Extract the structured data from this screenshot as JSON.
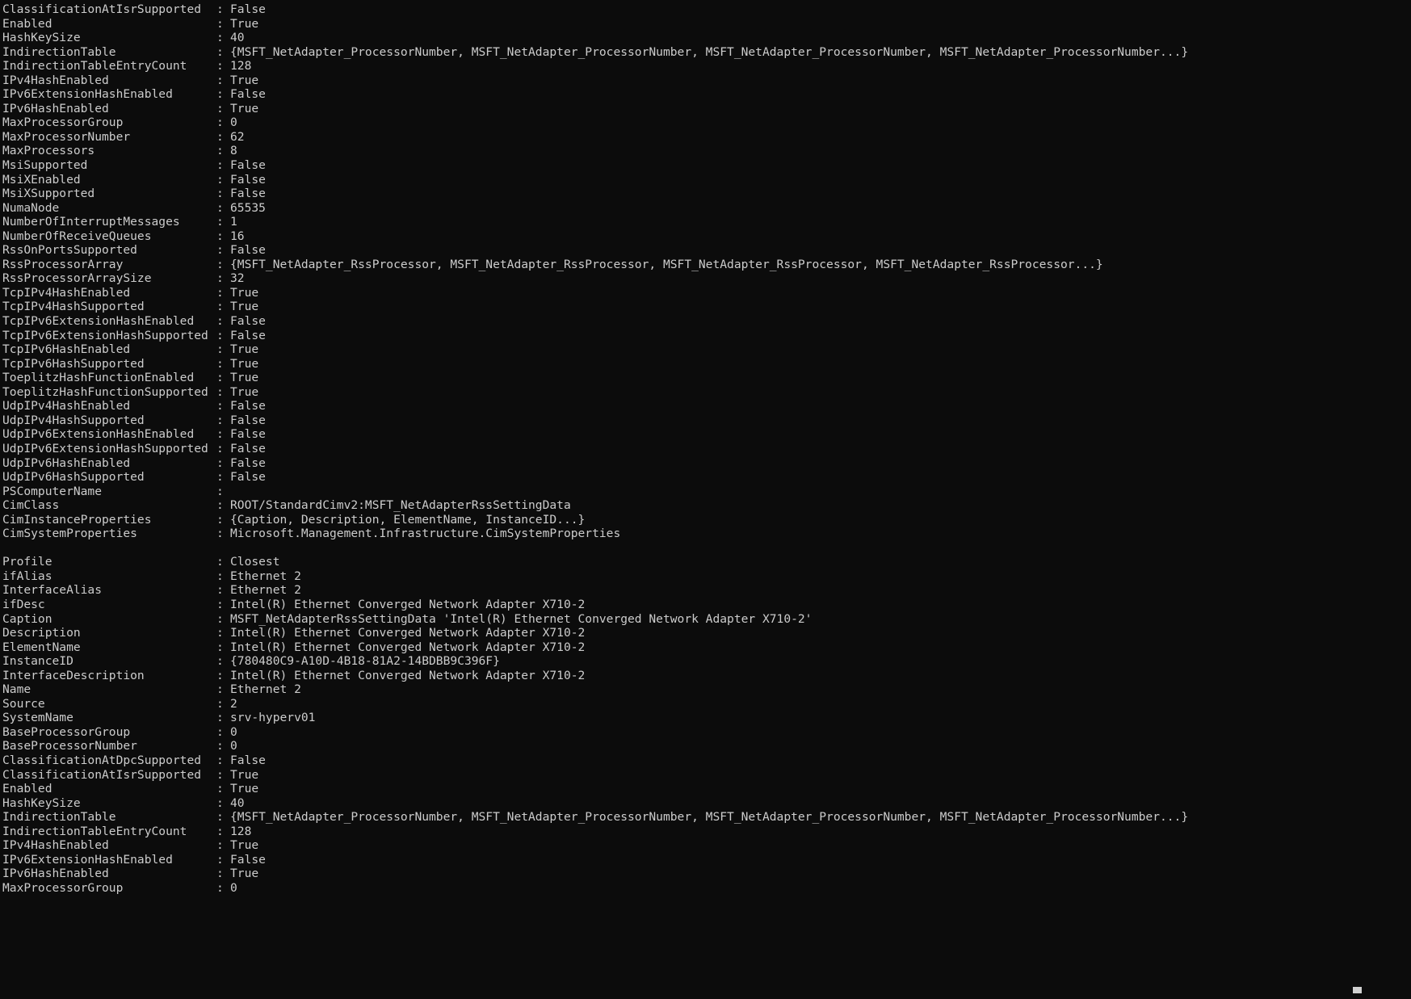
{
  "window": {
    "title": "Windows PowerShell",
    "background_color": "#0c0c0c",
    "foreground_color": "#cccccc",
    "separator": ":"
  },
  "records": [
    {
      "id": "record-1-partial",
      "lines": [
        {
          "name": "ClassificationAtIsrSupported",
          "value": "False"
        },
        {
          "name": "Enabled",
          "value": "True"
        },
        {
          "name": "HashKeySize",
          "value": "40"
        },
        {
          "name": "IndirectionTable",
          "value": "{MSFT_NetAdapter_ProcessorNumber, MSFT_NetAdapter_ProcessorNumber, MSFT_NetAdapter_ProcessorNumber, MSFT_NetAdapter_ProcessorNumber...}"
        },
        {
          "name": "IndirectionTableEntryCount",
          "value": "128"
        },
        {
          "name": "IPv4HashEnabled",
          "value": "True"
        },
        {
          "name": "IPv6ExtensionHashEnabled",
          "value": "False"
        },
        {
          "name": "IPv6HashEnabled",
          "value": "True"
        },
        {
          "name": "MaxProcessorGroup",
          "value": "0"
        },
        {
          "name": "MaxProcessorNumber",
          "value": "62"
        },
        {
          "name": "MaxProcessors",
          "value": "8"
        },
        {
          "name": "MsiSupported",
          "value": "False"
        },
        {
          "name": "MsiXEnabled",
          "value": "False"
        },
        {
          "name": "MsiXSupported",
          "value": "False"
        },
        {
          "name": "NumaNode",
          "value": "65535"
        },
        {
          "name": "NumberOfInterruptMessages",
          "value": "1"
        },
        {
          "name": "NumberOfReceiveQueues",
          "value": "16"
        },
        {
          "name": "RssOnPortsSupported",
          "value": "False"
        },
        {
          "name": "RssProcessorArray",
          "value": "{MSFT_NetAdapter_RssProcessor, MSFT_NetAdapter_RssProcessor, MSFT_NetAdapter_RssProcessor, MSFT_NetAdapter_RssProcessor...}"
        },
        {
          "name": "RssProcessorArraySize",
          "value": "32"
        },
        {
          "name": "TcpIPv4HashEnabled",
          "value": "True"
        },
        {
          "name": "TcpIPv4HashSupported",
          "value": "True"
        },
        {
          "name": "TcpIPv6ExtensionHashEnabled",
          "value": "False"
        },
        {
          "name": "TcpIPv6ExtensionHashSupported",
          "value": "False"
        },
        {
          "name": "TcpIPv6HashEnabled",
          "value": "True"
        },
        {
          "name": "TcpIPv6HashSupported",
          "value": "True"
        },
        {
          "name": "ToeplitzHashFunctionEnabled",
          "value": "True"
        },
        {
          "name": "ToeplitzHashFunctionSupported",
          "value": "True"
        },
        {
          "name": "UdpIPv4HashEnabled",
          "value": "False"
        },
        {
          "name": "UdpIPv4HashSupported",
          "value": "False"
        },
        {
          "name": "UdpIPv6ExtensionHashEnabled",
          "value": "False"
        },
        {
          "name": "UdpIPv6ExtensionHashSupported",
          "value": "False"
        },
        {
          "name": "UdpIPv6HashEnabled",
          "value": "False"
        },
        {
          "name": "UdpIPv6HashSupported",
          "value": "False"
        },
        {
          "name": "PSComputerName",
          "value": ""
        },
        {
          "name": "CimClass",
          "value": "ROOT/StandardCimv2:MSFT_NetAdapterRssSettingData"
        },
        {
          "name": "CimInstanceProperties",
          "value": "{Caption, Description, ElementName, InstanceID...}"
        },
        {
          "name": "CimSystemProperties",
          "value": "Microsoft.Management.Infrastructure.CimSystemProperties"
        }
      ]
    },
    {
      "id": "record-2",
      "lines": [
        {
          "name": "Profile",
          "value": "Closest"
        },
        {
          "name": "ifAlias",
          "value": "Ethernet 2"
        },
        {
          "name": "InterfaceAlias",
          "value": "Ethernet 2"
        },
        {
          "name": "ifDesc",
          "value": "Intel(R) Ethernet Converged Network Adapter X710-2"
        },
        {
          "name": "Caption",
          "value": "MSFT_NetAdapterRssSettingData 'Intel(R) Ethernet Converged Network Adapter X710-2'"
        },
        {
          "name": "Description",
          "value": "Intel(R) Ethernet Converged Network Adapter X710-2"
        },
        {
          "name": "ElementName",
          "value": "Intel(R) Ethernet Converged Network Adapter X710-2"
        },
        {
          "name": "InstanceID",
          "value": "{780480C9-A10D-4B18-81A2-14BDBB9C396F}"
        },
        {
          "name": "InterfaceDescription",
          "value": "Intel(R) Ethernet Converged Network Adapter X710-2"
        },
        {
          "name": "Name",
          "value": "Ethernet 2"
        },
        {
          "name": "Source",
          "value": "2"
        },
        {
          "name": "SystemName",
          "value": "srv-hyperv01"
        },
        {
          "name": "BaseProcessorGroup",
          "value": "0"
        },
        {
          "name": "BaseProcessorNumber",
          "value": "0"
        },
        {
          "name": "ClassificationAtDpcSupported",
          "value": "False"
        },
        {
          "name": "ClassificationAtIsrSupported",
          "value": "True"
        },
        {
          "name": "Enabled",
          "value": "True"
        },
        {
          "name": "HashKeySize",
          "value": "40"
        },
        {
          "name": "IndirectionTable",
          "value": "{MSFT_NetAdapter_ProcessorNumber, MSFT_NetAdapter_ProcessorNumber, MSFT_NetAdapter_ProcessorNumber, MSFT_NetAdapter_ProcessorNumber...}"
        },
        {
          "name": "IndirectionTableEntryCount",
          "value": "128"
        },
        {
          "name": "IPv4HashEnabled",
          "value": "True"
        },
        {
          "name": "IPv6ExtensionHashEnabled",
          "value": "False"
        },
        {
          "name": "IPv6HashEnabled",
          "value": "True"
        },
        {
          "name": "MaxProcessorGroup",
          "value": "0"
        }
      ]
    }
  ]
}
